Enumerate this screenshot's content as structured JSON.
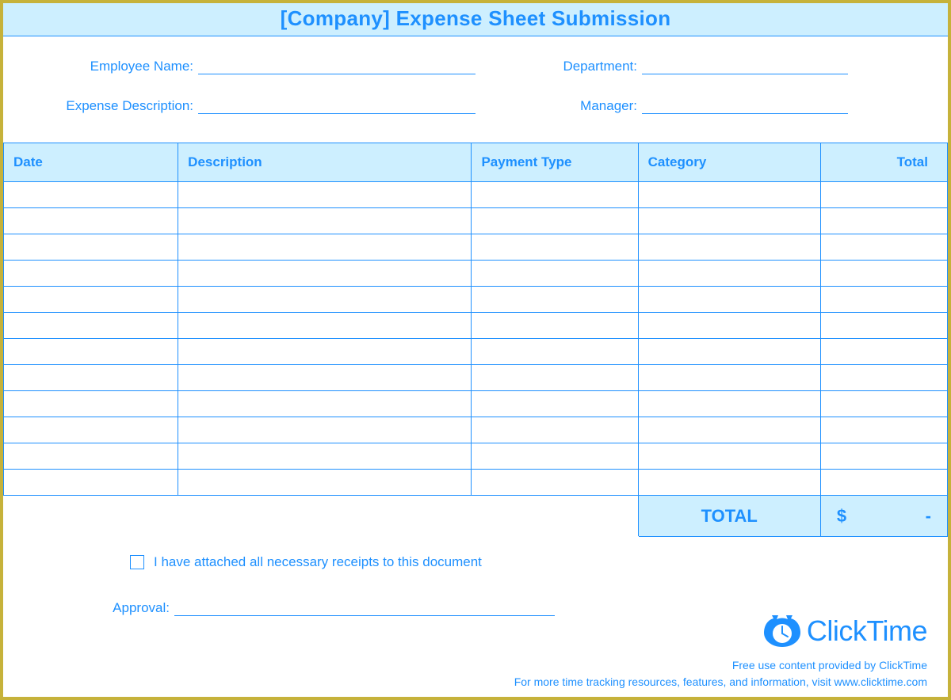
{
  "title": "[Company] Expense Sheet Submission",
  "fields": {
    "employee_name_label": "Employee Name:",
    "employee_name_value": "",
    "department_label": "Department:",
    "department_value": "",
    "expense_desc_label": "Expense Description:",
    "expense_desc_value": "",
    "manager_label": "Manager:",
    "manager_value": ""
  },
  "table": {
    "headers": {
      "date": "Date",
      "description": "Description",
      "payment_type": "Payment Type",
      "category": "Category",
      "total": "Total"
    },
    "rows": [
      {
        "date": "",
        "description": "",
        "payment_type": "",
        "category": "",
        "total": ""
      },
      {
        "date": "",
        "description": "",
        "payment_type": "",
        "category": "",
        "total": ""
      },
      {
        "date": "",
        "description": "",
        "payment_type": "",
        "category": "",
        "total": ""
      },
      {
        "date": "",
        "description": "",
        "payment_type": "",
        "category": "",
        "total": ""
      },
      {
        "date": "",
        "description": "",
        "payment_type": "",
        "category": "",
        "total": ""
      },
      {
        "date": "",
        "description": "",
        "payment_type": "",
        "category": "",
        "total": ""
      },
      {
        "date": "",
        "description": "",
        "payment_type": "",
        "category": "",
        "total": ""
      },
      {
        "date": "",
        "description": "",
        "payment_type": "",
        "category": "",
        "total": ""
      },
      {
        "date": "",
        "description": "",
        "payment_type": "",
        "category": "",
        "total": ""
      },
      {
        "date": "",
        "description": "",
        "payment_type": "",
        "category": "",
        "total": ""
      },
      {
        "date": "",
        "description": "",
        "payment_type": "",
        "category": "",
        "total": ""
      },
      {
        "date": "",
        "description": "",
        "payment_type": "",
        "category": "",
        "total": ""
      }
    ],
    "total_label": "TOTAL",
    "total_currency": "$",
    "total_value": "-"
  },
  "footer": {
    "receipts_checked": false,
    "receipts_label": "I have attached all necessary receipts to this document",
    "approval_label": "Approval:",
    "approval_value": "",
    "logo_text": "ClickTime",
    "line1": "Free use content provided by ClickTime",
    "line2": "For more time tracking resources, features, and information, visit www.clicktime.com"
  }
}
